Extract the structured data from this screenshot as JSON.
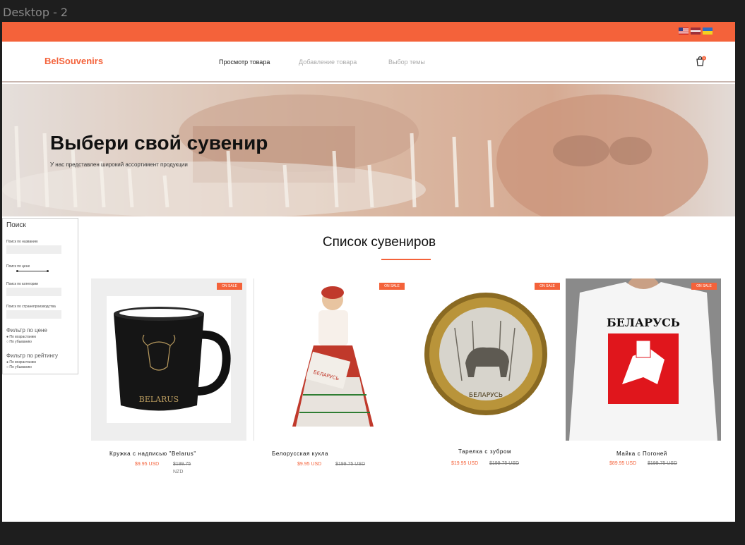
{
  "canvas_label": "Desktop - 2",
  "flags": [
    "us-flag-icon",
    "latvia-flag-icon",
    "ukraine-flag-icon"
  ],
  "header": {
    "logo": "BelSouvenirs",
    "nav": [
      "Просмотр товара",
      "Добавление товара",
      "Выбор темы"
    ],
    "cart_count": "0"
  },
  "hero": {
    "title": "Выбери свой сувенир",
    "subtitle": "У нас представлен широкий ассортимент продукции"
  },
  "sidebar": {
    "title": "Поиск",
    "search_by_name": "Поиск по названию",
    "search_by_price": "Поиск по цене",
    "search_by_category": "Поиск по категории",
    "search_by_country": "Поиск по странепроизводства",
    "filter_price": "Фильтр по цене",
    "filter_price_asc": "По возрастанию",
    "filter_price_desc": "По убыванию",
    "filter_rating": "Фильтр по рейтингу",
    "filter_rating_asc": "По возрастанию",
    "filter_rating_desc": "По убыванию"
  },
  "main": {
    "section_title": "Список сувениров",
    "products": [
      {
        "name": "Кружка с надписью \"Belarus\"",
        "price": "$9.95 USD",
        "old_price": "$199.75",
        "old_currency": "NZD",
        "badge": "ON SALE"
      },
      {
        "name": "Белорусская кукла",
        "price": "$9.95 USD",
        "old_price": "$199.75 USD",
        "badge": "ON SALE"
      },
      {
        "name": "Тарелка с зубром",
        "price": "$19.95 USD",
        "old_price": "$199.75 USD",
        "badge": "ON SALE"
      },
      {
        "name": "Майка с Погоней",
        "price": "$89.95 USD",
        "old_price": "$199.75 USD",
        "badge": "ON SALE"
      }
    ],
    "image_text": {
      "mug": "BELARUS",
      "doll": "БЕЛАРУСЬ",
      "plate": "БЕЛАРУСЬ",
      "shirt": "БЕЛАРУСЬ"
    }
  },
  "colors": {
    "accent": "#f4623a",
    "background": "#1e1e1e",
    "panel": "#ffffff"
  }
}
